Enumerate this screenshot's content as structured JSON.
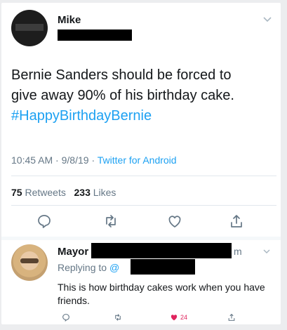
{
  "tweet": {
    "author_name": "Mike",
    "text_line1": "Bernie Sanders should be forced to",
    "text_line2": "give away 90% of his birthday cake.",
    "hashtag": "#HappyBirthdayBernie",
    "time": "10:45 AM",
    "date": "9/8/19",
    "source": "Twitter for Android",
    "retweets_count": "75",
    "retweets_label": "Retweets",
    "likes_count": "233",
    "likes_label": "Likes"
  },
  "reply": {
    "author_name": "Mayor",
    "time_suffix": "m",
    "replying_label": "Replying to",
    "replying_at": "@",
    "text": "This is how birthday cakes work when you have friends.",
    "like_count": "24"
  },
  "icons": {
    "reply": "reply-icon",
    "retweet": "retweet-icon",
    "like": "heart-icon",
    "share": "share-icon",
    "menu": "chevron-down-icon"
  },
  "colors": {
    "link": "#1da1f2",
    "muted": "#657786",
    "like": "#e0245e"
  }
}
